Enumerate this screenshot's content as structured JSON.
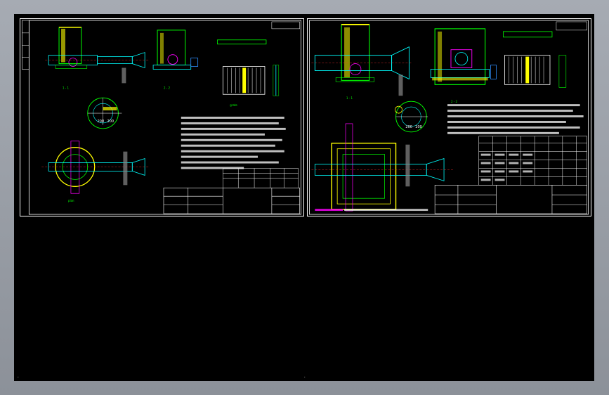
{
  "viewport": {
    "background": "#000000",
    "frame": "#ffffff"
  },
  "colors": {
    "green": "#00ff00",
    "cyan": "#00ffff",
    "yellow": "#ffff00",
    "magenta": "#ff00ff",
    "white": "#ffffff",
    "red": "#ff3030",
    "blue": "#3090ff"
  },
  "sheets": [
    {
      "name": "left-drawing-sheet",
      "labels": {
        "d1": "200",
        "d2": "200"
      }
    },
    {
      "name": "right-drawing-sheet",
      "labels": {
        "d1": "200",
        "d2": "200"
      }
    }
  ]
}
